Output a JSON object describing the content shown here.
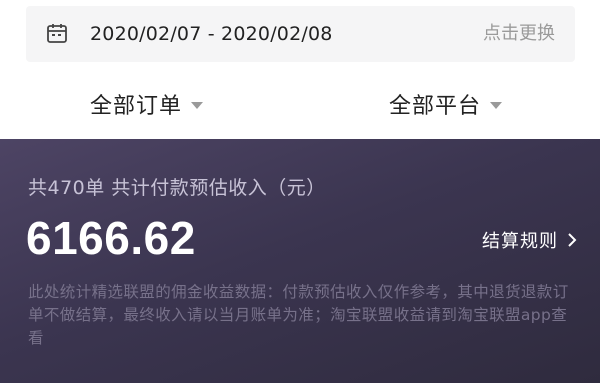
{
  "date_bar": {
    "icon": "calendar-icon",
    "range": "2020/02/07 - 2020/02/08",
    "change_label": "点击更换"
  },
  "filters": {
    "orders_label": "全部订单",
    "platforms_label": "全部平台"
  },
  "summary": {
    "title": "共470单 共计付款预估收入（元）",
    "amount": "6166.62",
    "rules_label": "结算规则",
    "note": "此处统计精选联盟的佣金收益数据：付款预估收入仅作参考，其中退货退款订单不做结算，最终收入请以当月账单为准；淘宝联盟收益请到淘宝联盟app查看"
  },
  "colors": {
    "card_bg": "#3b3550",
    "amount": "#ffffff",
    "muted_text": "#9a9a9a"
  }
}
